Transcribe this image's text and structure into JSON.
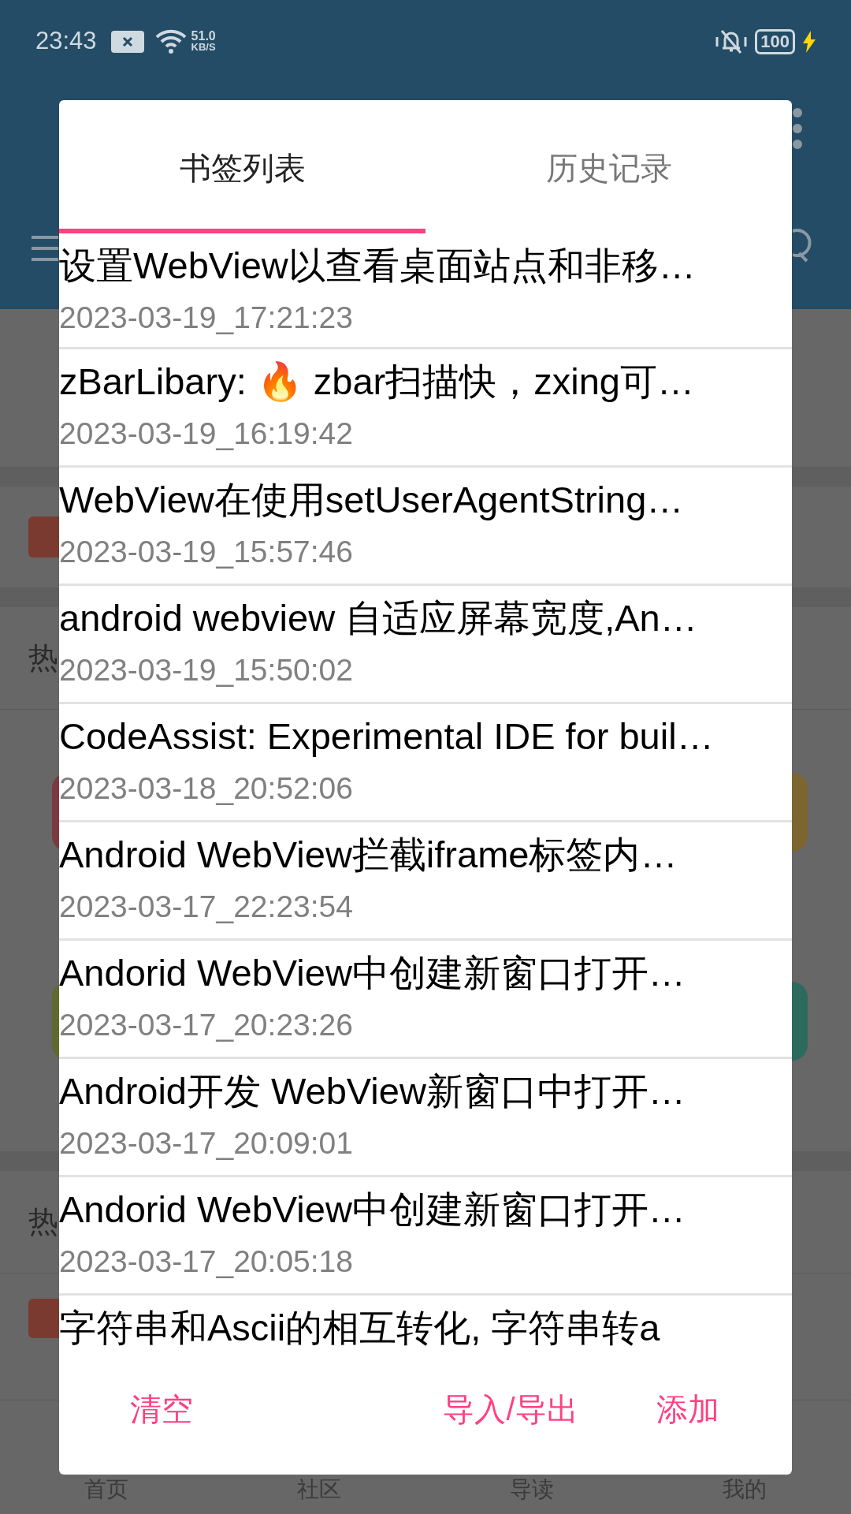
{
  "status_bar": {
    "time": "23:43",
    "net_speed": "51.0",
    "net_unit": "KB/S",
    "battery": "100"
  },
  "background": {
    "side_texts": [
      "热",
      "热"
    ],
    "nav": [
      "首页",
      "社区",
      "导读",
      "我的"
    ]
  },
  "dialog": {
    "tabs": [
      {
        "label": "书签列表",
        "selected": true
      },
      {
        "label": "历史记录",
        "selected": false
      }
    ],
    "items": [
      {
        "title": "设置WebView以查看桌面站点和非移…",
        "time": "2023-03-19_17:21:23"
      },
      {
        "title": "zBarLibary: 🔥 zbar扫描快，zxing可…",
        "time": "2023-03-19_16:19:42"
      },
      {
        "title": "WebView在使用setUserAgentString…",
        "time": "2023-03-19_15:57:46"
      },
      {
        "title": "android webview 自适应屏幕宽度,An…",
        "time": "2023-03-19_15:50:02"
      },
      {
        "title": "CodeAssist: Experimental IDE for buil…",
        "time": "2023-03-18_20:52:06"
      },
      {
        "title": "Android WebView拦截iframe标签内…",
        "time": "2023-03-17_22:23:54"
      },
      {
        "title": "Andorid WebView中创建新窗口打开…",
        "time": "2023-03-17_20:23:26"
      },
      {
        "title": "Android开发 WebView新窗口中打开…",
        "time": "2023-03-17_20:09:01"
      },
      {
        "title": "Andorid WebView中创建新窗口打开…",
        "time": "2023-03-17_20:05:18"
      },
      {
        "title": "字符串和Ascii的相互转化, 字符串转a"
      }
    ],
    "buttons": [
      "清空",
      "导入/导出",
      "添加"
    ]
  }
}
